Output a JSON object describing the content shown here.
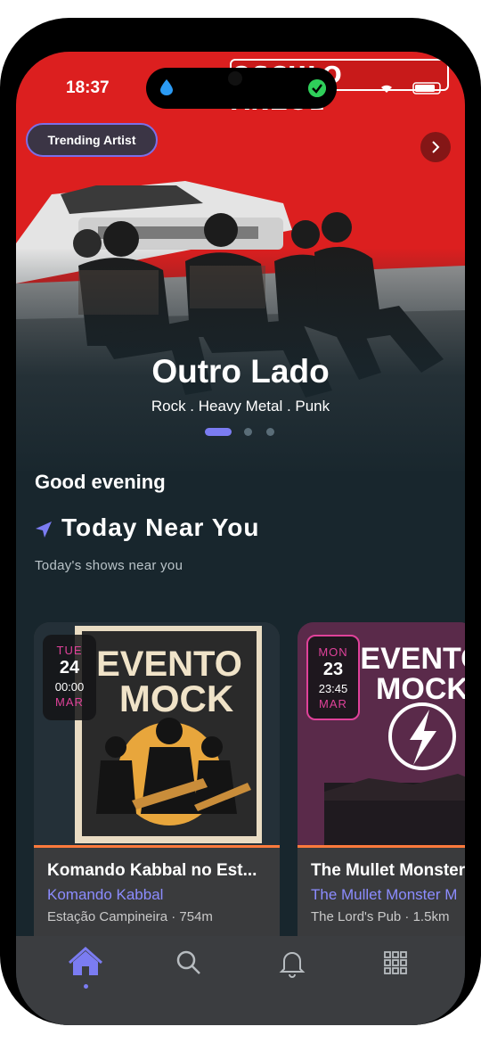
{
  "status_bar": {
    "time": "18:37"
  },
  "hero": {
    "banner_text": "OSCULO ANZOL",
    "badge": "Trending Artist",
    "band_name": "Outro Lado",
    "genres": "Rock . Heavy Metal . Punk",
    "pager": {
      "count": 3,
      "active": 1
    }
  },
  "greeting": "Good evening",
  "section": {
    "title": "Today Near You",
    "subtitle": "Today's shows near you"
  },
  "events": [
    {
      "day": "TUE",
      "date": "24",
      "time": "00:00",
      "month": "MAR",
      "poster_text_1": "EVENTO",
      "poster_text_2": "MOCK",
      "title": "Komando Kabbal no Est...",
      "artist": "Komando Kabbal",
      "venue": "Estação Campineira · 754m"
    },
    {
      "day": "MON",
      "date": "23",
      "time": "23:45",
      "month": "MAR",
      "poster_text_1": "EVENTO",
      "poster_text_2": "MOCK",
      "title": "The Mullet Monster",
      "artist": "The Mullet Monster M",
      "venue": "The Lord's Pub · 1.5km"
    }
  ],
  "tabs": [
    {
      "icon": "home-icon",
      "active": true
    },
    {
      "icon": "search-icon",
      "active": false
    },
    {
      "icon": "bell-icon",
      "active": false
    },
    {
      "icon": "grid-icon",
      "active": false
    }
  ],
  "colors": {
    "accent": "#7b7cf2",
    "hero_red": "#dc1f1f",
    "background": "#18262d",
    "date_pink": "#e0429a",
    "card_stripe": "#ff7a3c"
  }
}
